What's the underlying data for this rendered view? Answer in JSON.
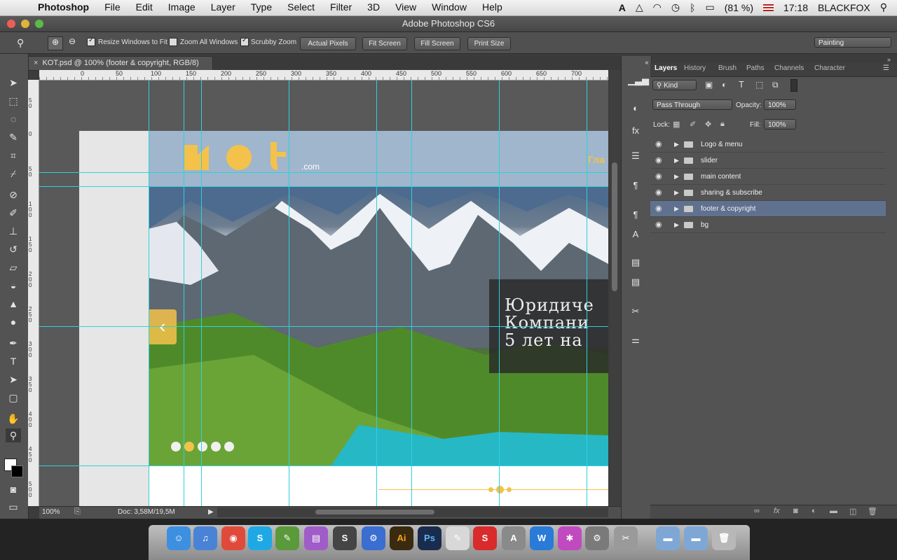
{
  "menubar": {
    "app_name": "Photoshop",
    "items": [
      "File",
      "Edit",
      "Image",
      "Layer",
      "Type",
      "Select",
      "Filter",
      "3D",
      "View",
      "Window",
      "Help"
    ],
    "battery": "(81 %)",
    "clock": "17:18",
    "user": "BLACKFOX"
  },
  "window": {
    "title": "Adobe Photoshop CS6"
  },
  "options": {
    "resize_windows": "Resize Windows to Fit",
    "zoom_all": "Zoom All Windows",
    "scrubby_zoom": "Scrubby Zoom",
    "actual_pixels": "Actual Pixels",
    "fit_screen": "Fit Screen",
    "fill_screen": "Fill Screen",
    "print_size": "Print Size",
    "workspace": "Painting"
  },
  "document": {
    "tab_title": "KOT.psd @ 100% (footer & copyright, RGB/8)",
    "zoom": "100%",
    "doc_info": "Doc: 3,58M/19,5M"
  },
  "rulers": {
    "h_ticks": [
      "0",
      "50",
      "100",
      "150",
      "200",
      "250",
      "300",
      "350",
      "400",
      "450",
      "500",
      "550",
      "600",
      "650",
      "700"
    ],
    "v_ticks": [
      "5 0",
      "0",
      "5 0",
      "1 0 0",
      "1 5 0",
      "2 0 0",
      "2 5 0",
      "3 0 0",
      "3 5 0",
      "4 0 0",
      "4 5 0",
      "5 0 0"
    ]
  },
  "canvas": {
    "logo_suffix": ".com",
    "nav_text": "Гла",
    "slider_text_lines": [
      "Юридиче",
      "Компани",
      "5 лет на"
    ],
    "dots_count": 5,
    "active_dot": 2
  },
  "layers_panel": {
    "tabs": [
      "Layers",
      "History",
      "Brush",
      "Paths",
      "Channels",
      "Character"
    ],
    "kind_label": "Kind",
    "blend_mode": "Pass Through",
    "opacity_label": "Opacity:",
    "opacity": "100%",
    "lock_label": "Lock:",
    "fill_label": "Fill:",
    "fill": "100%",
    "layers": [
      {
        "name": "Logo & menu",
        "selected": false
      },
      {
        "name": "slider",
        "selected": false
      },
      {
        "name": "main content",
        "selected": false
      },
      {
        "name": "sharing & subscribe",
        "selected": false
      },
      {
        "name": "footer & copyright",
        "selected": true
      },
      {
        "name": "bg",
        "selected": false
      }
    ]
  },
  "dock": {
    "apps": [
      "finder",
      "itunes",
      "chrome",
      "skype",
      "evernote",
      "sublime-beta",
      "sublime",
      "automator",
      "illustrator",
      "photoshop",
      "pages",
      "pro",
      "acrobat",
      "word",
      "colors",
      "system-prefs",
      "utility",
      "folder",
      "folder",
      "trash"
    ]
  },
  "colors": {
    "accent_yellow": "#f4c24a",
    "header_blue": "#9fb6cc",
    "guide": "#2fd0de",
    "selected_layer": "#5f718f"
  }
}
